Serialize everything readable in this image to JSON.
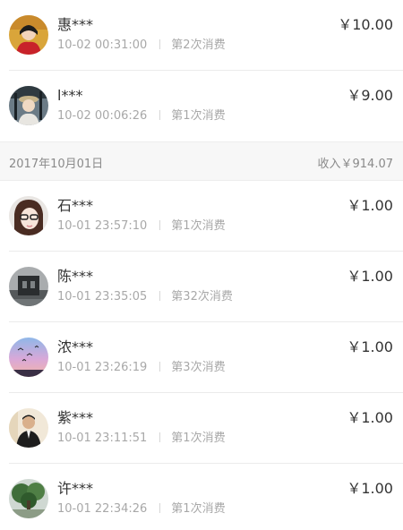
{
  "entries_top": [
    {
      "name": "惠***",
      "time": "10-02 00:31:00",
      "count": "第2次消费",
      "amount": "￥10.00",
      "avatar": "person-red-hood-icon"
    },
    {
      "name": "l***",
      "time": "10-02 00:06:26",
      "count": "第1次消费",
      "amount": "￥9.00",
      "avatar": "person-hat-icon"
    }
  ],
  "day_header": {
    "date": "2017年10月01日",
    "income": "收入￥914.07"
  },
  "entries": [
    {
      "name": "石***",
      "time": "10-01 23:57:10",
      "count": "第1次消费",
      "amount": "￥1.00",
      "avatar": "girl-glasses-icon"
    },
    {
      "name": "陈***",
      "time": "10-01 23:35:05",
      "count": "第32次消费",
      "amount": "￥1.00",
      "avatar": "dark-building-icon"
    },
    {
      "name": "浓***",
      "time": "10-01 23:26:19",
      "count": "第3次消费",
      "amount": "￥1.00",
      "avatar": "sunset-birds-icon"
    },
    {
      "name": "紫***",
      "time": "10-01 23:11:51",
      "count": "第1次消费",
      "amount": "￥1.00",
      "avatar": "man-suit-icon"
    },
    {
      "name": "许***",
      "time": "10-01 22:34:26",
      "count": "第1次消费",
      "amount": "￥1.00",
      "avatar": "tree-landscape-icon"
    }
  ]
}
